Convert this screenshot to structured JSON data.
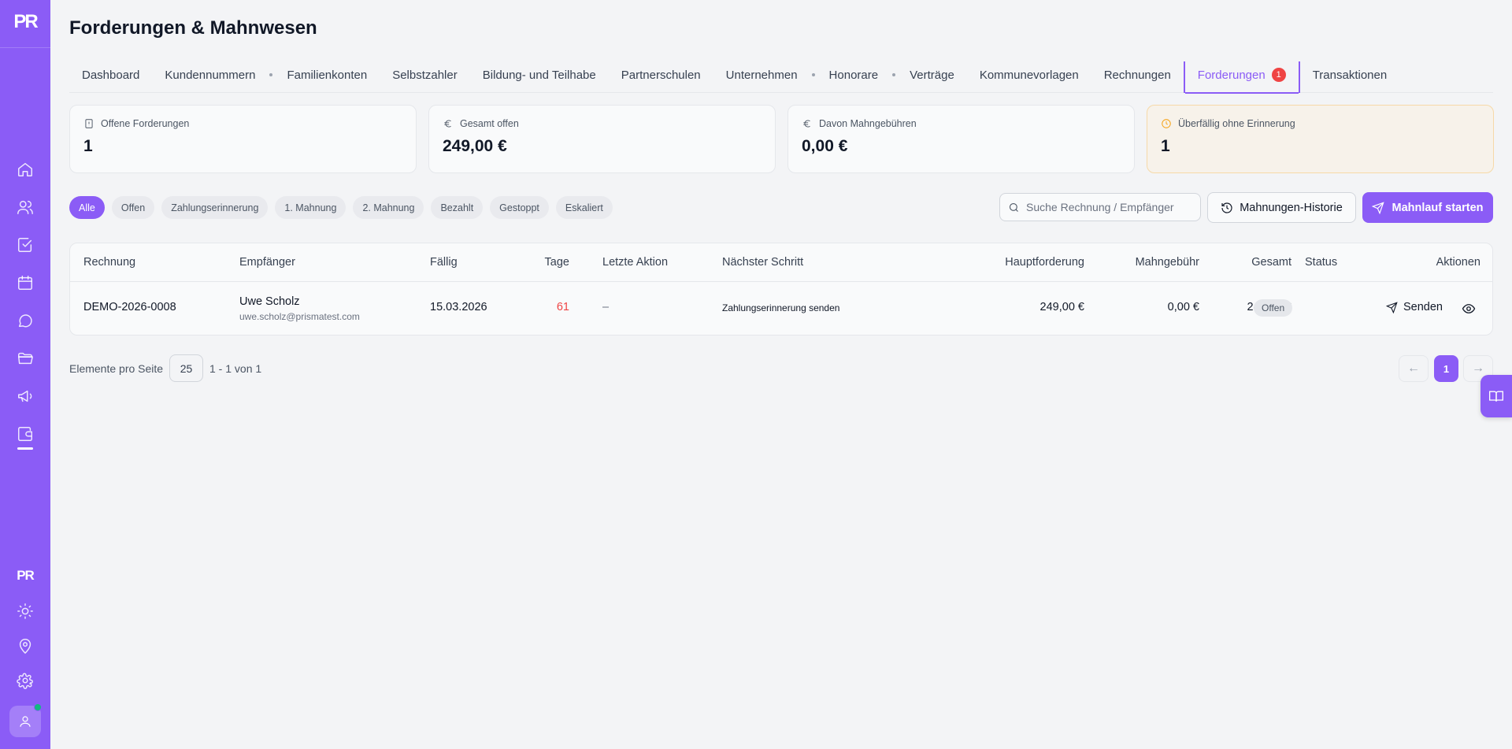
{
  "app": {
    "logo": "PR",
    "logo_small": "PR"
  },
  "page": {
    "title": "Forderungen & Mahnwesen"
  },
  "tabs": [
    {
      "label": "Dashboard"
    },
    {
      "label": "Kundennummern"
    },
    {
      "label": "Familienkonten"
    },
    {
      "label": "Selbstzahler"
    },
    {
      "label": "Bildung- und Teilhabe"
    },
    {
      "label": "Partnerschulen"
    },
    {
      "label": "Unternehmen"
    },
    {
      "label": "Honorare"
    },
    {
      "label": "Verträge"
    },
    {
      "label": "Kommunevorlagen"
    },
    {
      "label": "Rechnungen"
    },
    {
      "label": "Forderungen",
      "badge": "1",
      "active": true
    },
    {
      "label": "Transaktionen"
    }
  ],
  "stats": [
    {
      "icon": "alert-file-icon",
      "label": "Offene Forderungen",
      "value": "1"
    },
    {
      "icon": "euro-icon",
      "label": "Gesamt offen",
      "value": "249,00 €"
    },
    {
      "icon": "euro-icon",
      "label": "Davon Mahngebühren",
      "value": "0,00 €"
    },
    {
      "icon": "clock-icon",
      "label": "Überfällig ohne Erinnerung",
      "value": "1"
    }
  ],
  "filters": [
    {
      "label": "Alle",
      "active": true
    },
    {
      "label": "Offen"
    },
    {
      "label": "Zahlungserinnerung"
    },
    {
      "label": "1. Mahnung"
    },
    {
      "label": "2. Mahnung"
    },
    {
      "label": "Bezahlt"
    },
    {
      "label": "Gestoppt"
    },
    {
      "label": "Eskaliert"
    }
  ],
  "search": {
    "placeholder": "Suche Rechnung / Empfänger",
    "value": ""
  },
  "buttons": {
    "history": "Mahnungen-Historie",
    "start": "Mahnlauf starten"
  },
  "table": {
    "columns": {
      "rechnung": "Rechnung",
      "empfaenger": "Empfänger",
      "faellig": "Fällig",
      "tage": "Tage",
      "letzte_aktion": "Letzte Aktion",
      "naechster_schritt": "Nächster Schritt",
      "hauptforderung": "Hauptforderung",
      "mahngebuehr": "Mahngebühr",
      "gesamt": "Gesamt",
      "status": "Status",
      "aktionen": "Aktionen"
    },
    "rows": [
      {
        "rechnung": "DEMO-2026-0008",
        "empfaenger_name": "Uwe Scholz",
        "empfaenger_email": "uwe.scholz@prismatest.com",
        "faellig": "15.03.2026",
        "tage": "61",
        "letzte_aktion": "–",
        "naechster_schritt": "Zahlungserinnerung senden",
        "hauptforderung": "249,00 €",
        "mahngebuehr": "0,00 €",
        "gesamt": "249,00 €",
        "status": "Offen",
        "action_send": "Senden"
      }
    ]
  },
  "pagination": {
    "per_page_label": "Elemente pro Seite",
    "per_page": "25",
    "range": "1 - 1 von 1",
    "current_page": "1",
    "prev": "←",
    "next": "→"
  },
  "colors": {
    "accent": "#8b5cf6",
    "danger": "#ef4444",
    "warning": "#f59e0b",
    "online": "#10b981"
  }
}
